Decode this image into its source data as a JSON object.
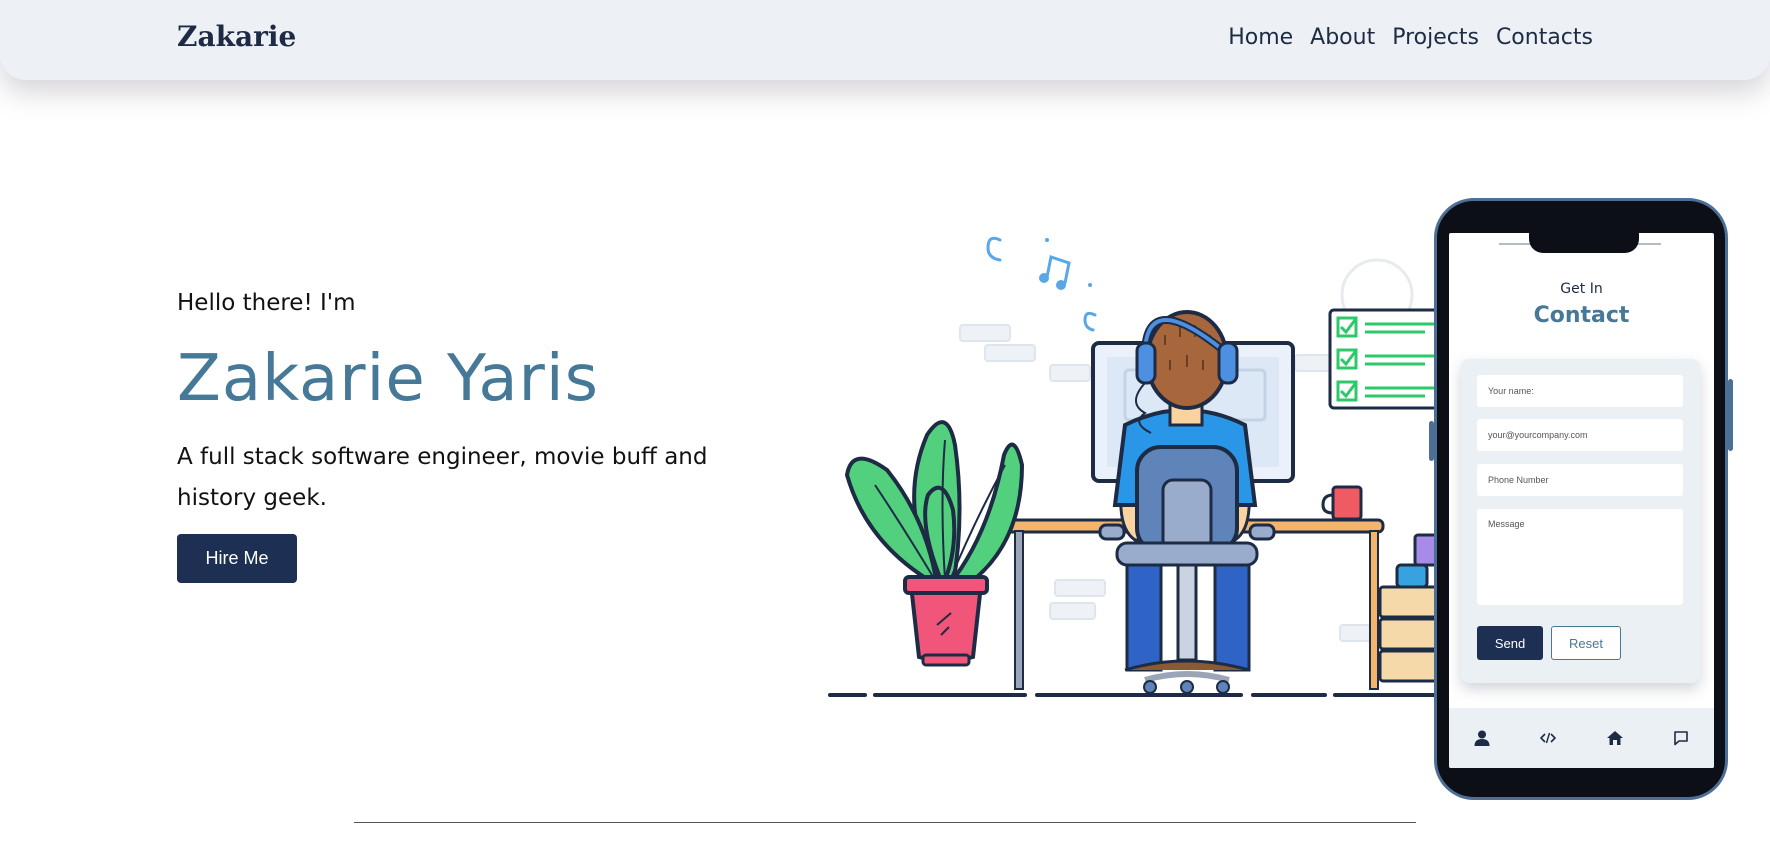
{
  "nav": {
    "brand": "Zakarie",
    "links": [
      "Home",
      "About",
      "Projects",
      "Contacts"
    ]
  },
  "hero": {
    "greeting": "Hello there! I'm",
    "name": "Zakarie Yaris",
    "tagline": "A full stack software engineer, movie buff and history geek.",
    "hire_button": "Hire Me"
  },
  "contact_phone": {
    "eyebrow": "Get In",
    "title": "Contact",
    "fields": {
      "name_placeholder": "Your name:",
      "email_placeholder": "your@yourcompany.com",
      "phone_placeholder": "Phone Number",
      "message_placeholder": "Message"
    },
    "send_label": "Send",
    "reset_label": "Reset",
    "tab_icons": [
      "user-icon",
      "code-icon",
      "home-icon",
      "chat-icon"
    ]
  },
  "colors": {
    "navy": "#1d2f52",
    "accent": "#467997",
    "nav_bg": "#edf1f5"
  }
}
